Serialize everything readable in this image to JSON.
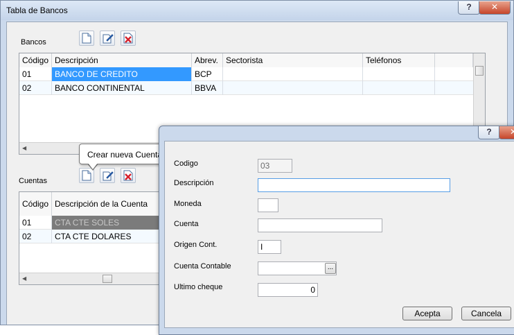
{
  "window": {
    "title": "Tabla de Bancos",
    "help_glyph": "?",
    "close_glyph": "✕"
  },
  "bancos": {
    "label": "Bancos",
    "columns": [
      "Código",
      "Descripción",
      "Abrev.",
      "Sectorista",
      "Teléfonos"
    ],
    "rows": [
      {
        "codigo": "01",
        "descripcion": "BANCO DE CREDITO",
        "abrev": "BCP",
        "sectorista": "",
        "telefonos": ""
      },
      {
        "codigo": "02",
        "descripcion": "BANCO CONTINENTAL",
        "abrev": "BBVA",
        "sectorista": "",
        "telefonos": ""
      }
    ]
  },
  "cuentas": {
    "label": "Cuentas",
    "columns": [
      "Código",
      "Descripción de la Cuenta"
    ],
    "rows": [
      {
        "codigo": "01",
        "descripcion": "CTA CTE SOLES"
      },
      {
        "codigo": "02",
        "descripcion": "CTA CTE DOLARES"
      }
    ]
  },
  "tooltip": {
    "text": "Crear nueva Cuenta"
  },
  "toolbar_icons": [
    "new-document-icon",
    "edit-document-icon",
    "delete-document-icon"
  ],
  "dialog": {
    "help_glyph": "?",
    "close_glyph": "✕",
    "fields": {
      "codigo": {
        "label": "Codigo",
        "value": "03"
      },
      "descripcion": {
        "label": "Descripción",
        "value": ""
      },
      "moneda": {
        "label": "Moneda",
        "value": ""
      },
      "cuenta": {
        "label": "Cuenta",
        "value": ""
      },
      "origen": {
        "label": "Origen Cont.",
        "value": "I"
      },
      "cuenta_contable": {
        "label": "Cuenta Contable",
        "value": "",
        "browse": "..."
      },
      "ultimo_cheque": {
        "label": "Ultimo cheque",
        "value": "0"
      }
    },
    "buttons": {
      "accept": "Acepta",
      "cancel": "Cancela"
    }
  },
  "colors": {
    "selection": "#3399ff",
    "inactive_selection": "#7b7b7b",
    "frame": "#cbd9ec",
    "close": "#c6452a"
  }
}
